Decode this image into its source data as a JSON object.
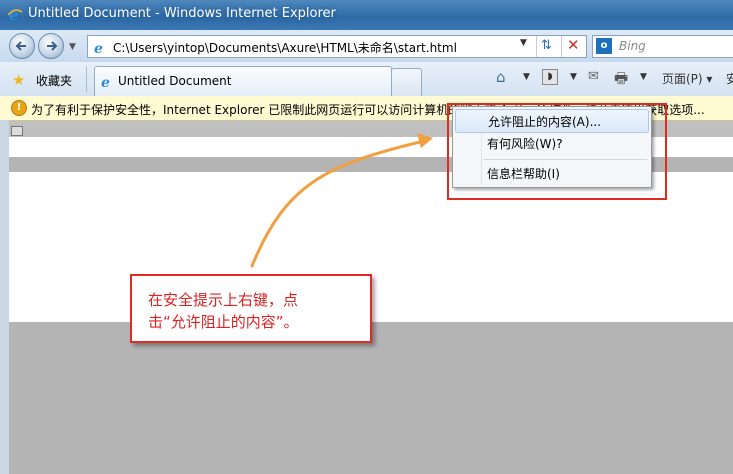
{
  "window": {
    "title": "Untitled Document - Windows Internet Explorer"
  },
  "address_bar": {
    "url": "C:\\Users\\yintop\\Documents\\Axure\\HTML\\未命名\\start.html"
  },
  "search": {
    "placeholder": "Bing"
  },
  "favorites": {
    "label": "收藏夹"
  },
  "tab": {
    "title": "Untitled Document"
  },
  "toolbar": {
    "page_label": "页面(P) ▾",
    "safety_label": "安"
  },
  "info_bar": {
    "text": "为了有利于保护安全性，Internet Explorer 已限制此网页运行可以访问计算机的脚本或 ActiveX 控件。请单击这里获取选项..."
  },
  "context_menu": {
    "items": [
      {
        "label": "允许阻止的内容(A)..."
      },
      {
        "label": "有何风险(W)?"
      },
      {
        "label": "信息栏帮助(I)"
      }
    ]
  },
  "callout": {
    "line1": "在安全提示上右键，点",
    "line2": "击“允许阻止的内容”。"
  },
  "colors": {
    "highlight": "#e02b20",
    "arrow": "#f0a040",
    "info_bar_bg": "#fefbd3"
  }
}
